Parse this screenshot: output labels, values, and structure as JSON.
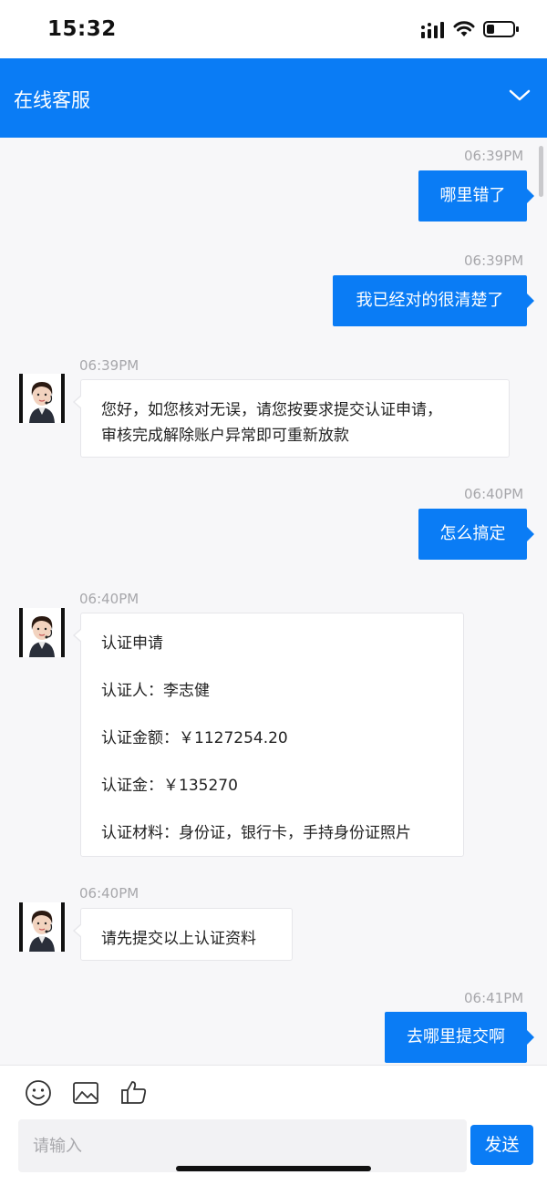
{
  "status_bar": {
    "time": "15:32"
  },
  "header": {
    "title": "在线客服"
  },
  "messages": [
    {
      "side": "out",
      "time": "06:39PM",
      "text": "哪里错了"
    },
    {
      "side": "out",
      "time": "06:39PM",
      "text": "我已经对的很清楚了"
    },
    {
      "side": "in",
      "time": "06:39PM",
      "lines": [
        "您好，如您核对无误，请您按要求提交认证申请，",
        "审核完成解除账户异常即可重新放款"
      ]
    },
    {
      "side": "out",
      "time": "06:40PM",
      "text": "怎么搞定"
    },
    {
      "side": "in",
      "time": "06:40PM",
      "lines": [
        "认证申请",
        "认证人：李志健",
        "认证金额：￥1127254.20",
        "认证金：￥135270",
        "认证材料：身份证，银行卡，手持身份证照片"
      ]
    },
    {
      "side": "in",
      "time": "06:40PM",
      "lines": [
        "请先提交以上认证资料"
      ]
    },
    {
      "side": "out",
      "time": "06:41PM",
      "text": "去哪里提交啊"
    }
  ],
  "composer": {
    "placeholder": "请输入",
    "send_label": "发送",
    "tools": [
      "emoji-icon",
      "image-icon",
      "thumbs-up-icon"
    ]
  },
  "colors": {
    "accent": "#0a7cf5",
    "background": "#f7f7f9",
    "timestamp": "#a7a7ab"
  }
}
